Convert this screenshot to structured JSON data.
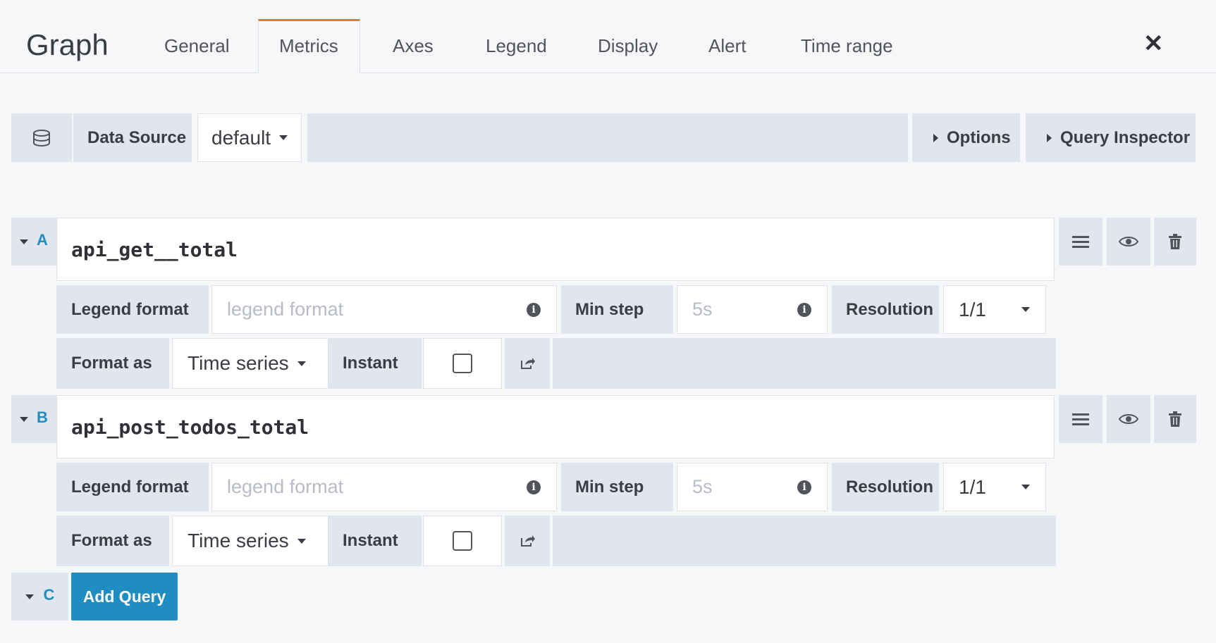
{
  "header": {
    "title": "Graph",
    "tabs": [
      "General",
      "Metrics",
      "Axes",
      "Legend",
      "Display",
      "Alert",
      "Time range"
    ],
    "active_tab": "Metrics",
    "close_icon": "close-icon"
  },
  "datasource": {
    "label": "Data Source",
    "value": "default",
    "options_label": "Options",
    "inspector_label": "Query Inspector"
  },
  "queries": [
    {
      "letter": "A",
      "expr": "api_get__total",
      "legend_label": "Legend format",
      "legend_placeholder": "legend format",
      "minstep_label": "Min step",
      "minstep_placeholder": "5s",
      "resolution_label": "Resolution",
      "resolution_value": "1/1",
      "format_label": "Format as",
      "format_value": "Time series",
      "instant_label": "Instant"
    },
    {
      "letter": "B",
      "expr": "api_post_todos_total",
      "legend_label": "Legend format",
      "legend_placeholder": "legend format",
      "minstep_label": "Min step",
      "minstep_placeholder": "5s",
      "resolution_label": "Resolution",
      "resolution_value": "1/1",
      "format_label": "Format as",
      "format_value": "Time series",
      "instant_label": "Instant"
    }
  ],
  "add_query": {
    "letter": "C",
    "label": "Add Query"
  },
  "colors": {
    "accent_tab": "#eb7b18",
    "primary_button": "#1f8dc2",
    "query_letter": "#1f8dc2"
  }
}
